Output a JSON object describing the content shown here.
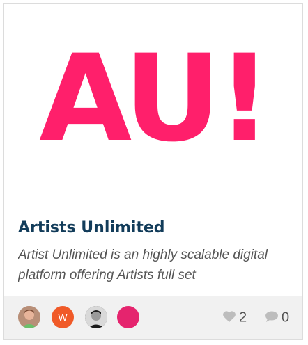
{
  "card": {
    "logo_text": "AU!",
    "title": "Artists Unlimited",
    "description": "Artist Unlimited is an highly scalable digital platform offering Artists full set",
    "colors": {
      "brand": "#ff1f6b",
      "title": "#123c5a",
      "footer_bg": "#f1f1f1"
    }
  },
  "footer": {
    "avatars": [
      {
        "icon": "user-photo-avatar"
      },
      {
        "initial": "W",
        "color": "#f05a28"
      },
      {
        "icon": "user-photo-avatar-bw"
      },
      {
        "icon": "pink-avatar",
        "color": "#e5246e"
      }
    ],
    "likes": "2",
    "comments": "0"
  }
}
